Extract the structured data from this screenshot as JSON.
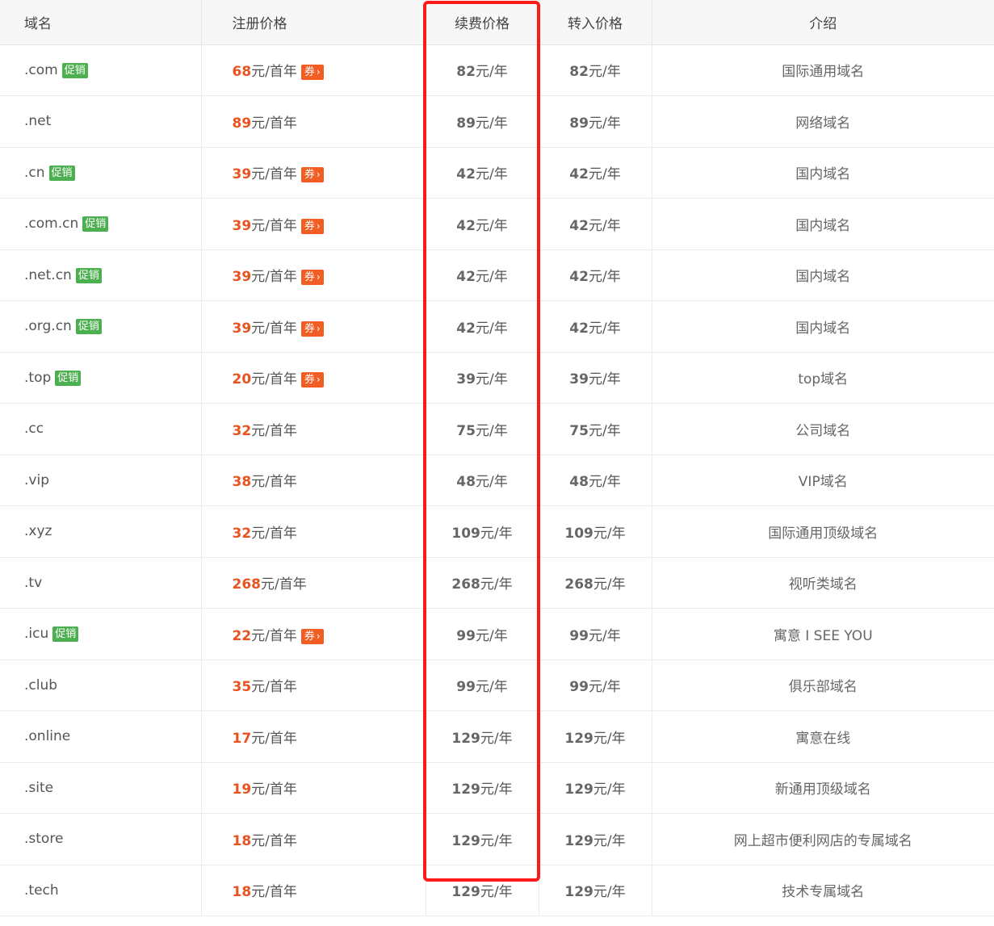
{
  "headers": {
    "domain": "域名",
    "register": "注册价格",
    "renew": "续费价格",
    "transfer": "转入价格",
    "desc": "介绍"
  },
  "labels": {
    "promo": "促销",
    "coupon": "券",
    "coupon_arrow": "›",
    "reg_unit": "元/首年",
    "year_unit": "元/年"
  },
  "colors": {
    "price_orange": "#e8531f",
    "promo_green": "#4caf50",
    "coupon_orange": "#f25d23",
    "highlight_red": "#ff1a1a"
  },
  "rows": [
    {
      "domain": ".com",
      "promo": true,
      "reg": "68",
      "coupon": true,
      "renew": "82",
      "transfer": "82",
      "desc": "国际通用域名"
    },
    {
      "domain": ".net",
      "promo": false,
      "reg": "89",
      "coupon": false,
      "renew": "89",
      "transfer": "89",
      "desc": "网络域名"
    },
    {
      "domain": ".cn",
      "promo": true,
      "reg": "39",
      "coupon": true,
      "renew": "42",
      "transfer": "42",
      "desc": "国内域名"
    },
    {
      "domain": ".com.cn",
      "promo": true,
      "reg": "39",
      "coupon": true,
      "renew": "42",
      "transfer": "42",
      "desc": "国内域名"
    },
    {
      "domain": ".net.cn",
      "promo": true,
      "reg": "39",
      "coupon": true,
      "renew": "42",
      "transfer": "42",
      "desc": "国内域名"
    },
    {
      "domain": ".org.cn",
      "promo": true,
      "reg": "39",
      "coupon": true,
      "renew": "42",
      "transfer": "42",
      "desc": "国内域名"
    },
    {
      "domain": ".top",
      "promo": true,
      "reg": "20",
      "coupon": true,
      "renew": "39",
      "transfer": "39",
      "desc": "top域名"
    },
    {
      "domain": ".cc",
      "promo": false,
      "reg": "32",
      "coupon": false,
      "renew": "75",
      "transfer": "75",
      "desc": "公司域名"
    },
    {
      "domain": ".vip",
      "promo": false,
      "reg": "38",
      "coupon": false,
      "renew": "48",
      "transfer": "48",
      "desc": "VIP域名"
    },
    {
      "domain": ".xyz",
      "promo": false,
      "reg": "32",
      "coupon": false,
      "renew": "109",
      "transfer": "109",
      "desc": "国际通用顶级域名"
    },
    {
      "domain": ".tv",
      "promo": false,
      "reg": "268",
      "coupon": false,
      "renew": "268",
      "transfer": "268",
      "desc": "视听类域名"
    },
    {
      "domain": ".icu",
      "promo": true,
      "reg": "22",
      "coupon": true,
      "renew": "99",
      "transfer": "99",
      "desc": "寓意 I SEE YOU"
    },
    {
      "domain": ".club",
      "promo": false,
      "reg": "35",
      "coupon": false,
      "renew": "99",
      "transfer": "99",
      "desc": "俱乐部域名"
    },
    {
      "domain": ".online",
      "promo": false,
      "reg": "17",
      "coupon": false,
      "renew": "129",
      "transfer": "129",
      "desc": "寓意在线"
    },
    {
      "domain": ".site",
      "promo": false,
      "reg": "19",
      "coupon": false,
      "renew": "129",
      "transfer": "129",
      "desc": "新通用顶级域名"
    },
    {
      "domain": ".store",
      "promo": false,
      "reg": "18",
      "coupon": false,
      "renew": "129",
      "transfer": "129",
      "desc": "网上超市便利网店的专属域名"
    },
    {
      "domain": ".tech",
      "promo": false,
      "reg": "18",
      "coupon": false,
      "renew": "129",
      "transfer": "129",
      "desc": "技术专属域名"
    }
  ]
}
